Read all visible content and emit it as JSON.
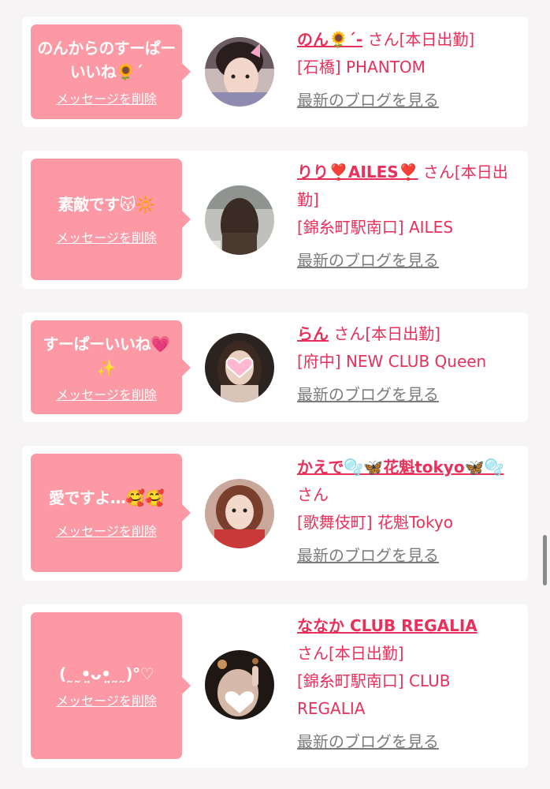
{
  "cards": [
    {
      "message": "のんからのすーぱーいいね🌻´",
      "delete_label": "メッセージを削除",
      "name": "のん🌻´-",
      "san": "さん",
      "status": "[本日出勤]",
      "shop": "[石橋] PHANTOM",
      "blog_link": "最新のブログを見る"
    },
    {
      "message": "素敵です😽🔆",
      "delete_label": "メッセージを削除",
      "name": "りり❣️AILES❣️",
      "san": "さん",
      "status": "[本日出勤]",
      "shop": "[錦糸町駅南口] AILES",
      "blog_link": "最新のブログを見る"
    },
    {
      "message": "すーぱーいいね💗✨",
      "delete_label": "メッセージを削除",
      "name": "らん",
      "san": "さん",
      "status": "[本日出勤]",
      "shop": "[府中] NEW CLUB Queen",
      "blog_link": "最新のブログを見る"
    },
    {
      "message": "愛ですよ…🥰🥰",
      "delete_label": "メッセージを削除",
      "name": "かえで🫧🦋花魁tokyo🦋🫧",
      "san": "さん",
      "status": "",
      "shop": "[歌舞伎町] 花魁Tokyo",
      "blog_link": "最新のブログを見る"
    },
    {
      "message": "(˷˷•̤ᴗ•̤˷˷)°♡",
      "delete_label": "メッセージを削除",
      "name": "ななか CLUB REGALIA",
      "san": "さん",
      "status": "[本日出勤]",
      "shop": "[錦糸町駅南口] CLUB REGALIA",
      "blog_link": "最新のブログを見る"
    }
  ],
  "colors": {
    "accent": "#e8305a",
    "bubble": "#fd98a5",
    "muted_link": "#7c7c7c"
  }
}
